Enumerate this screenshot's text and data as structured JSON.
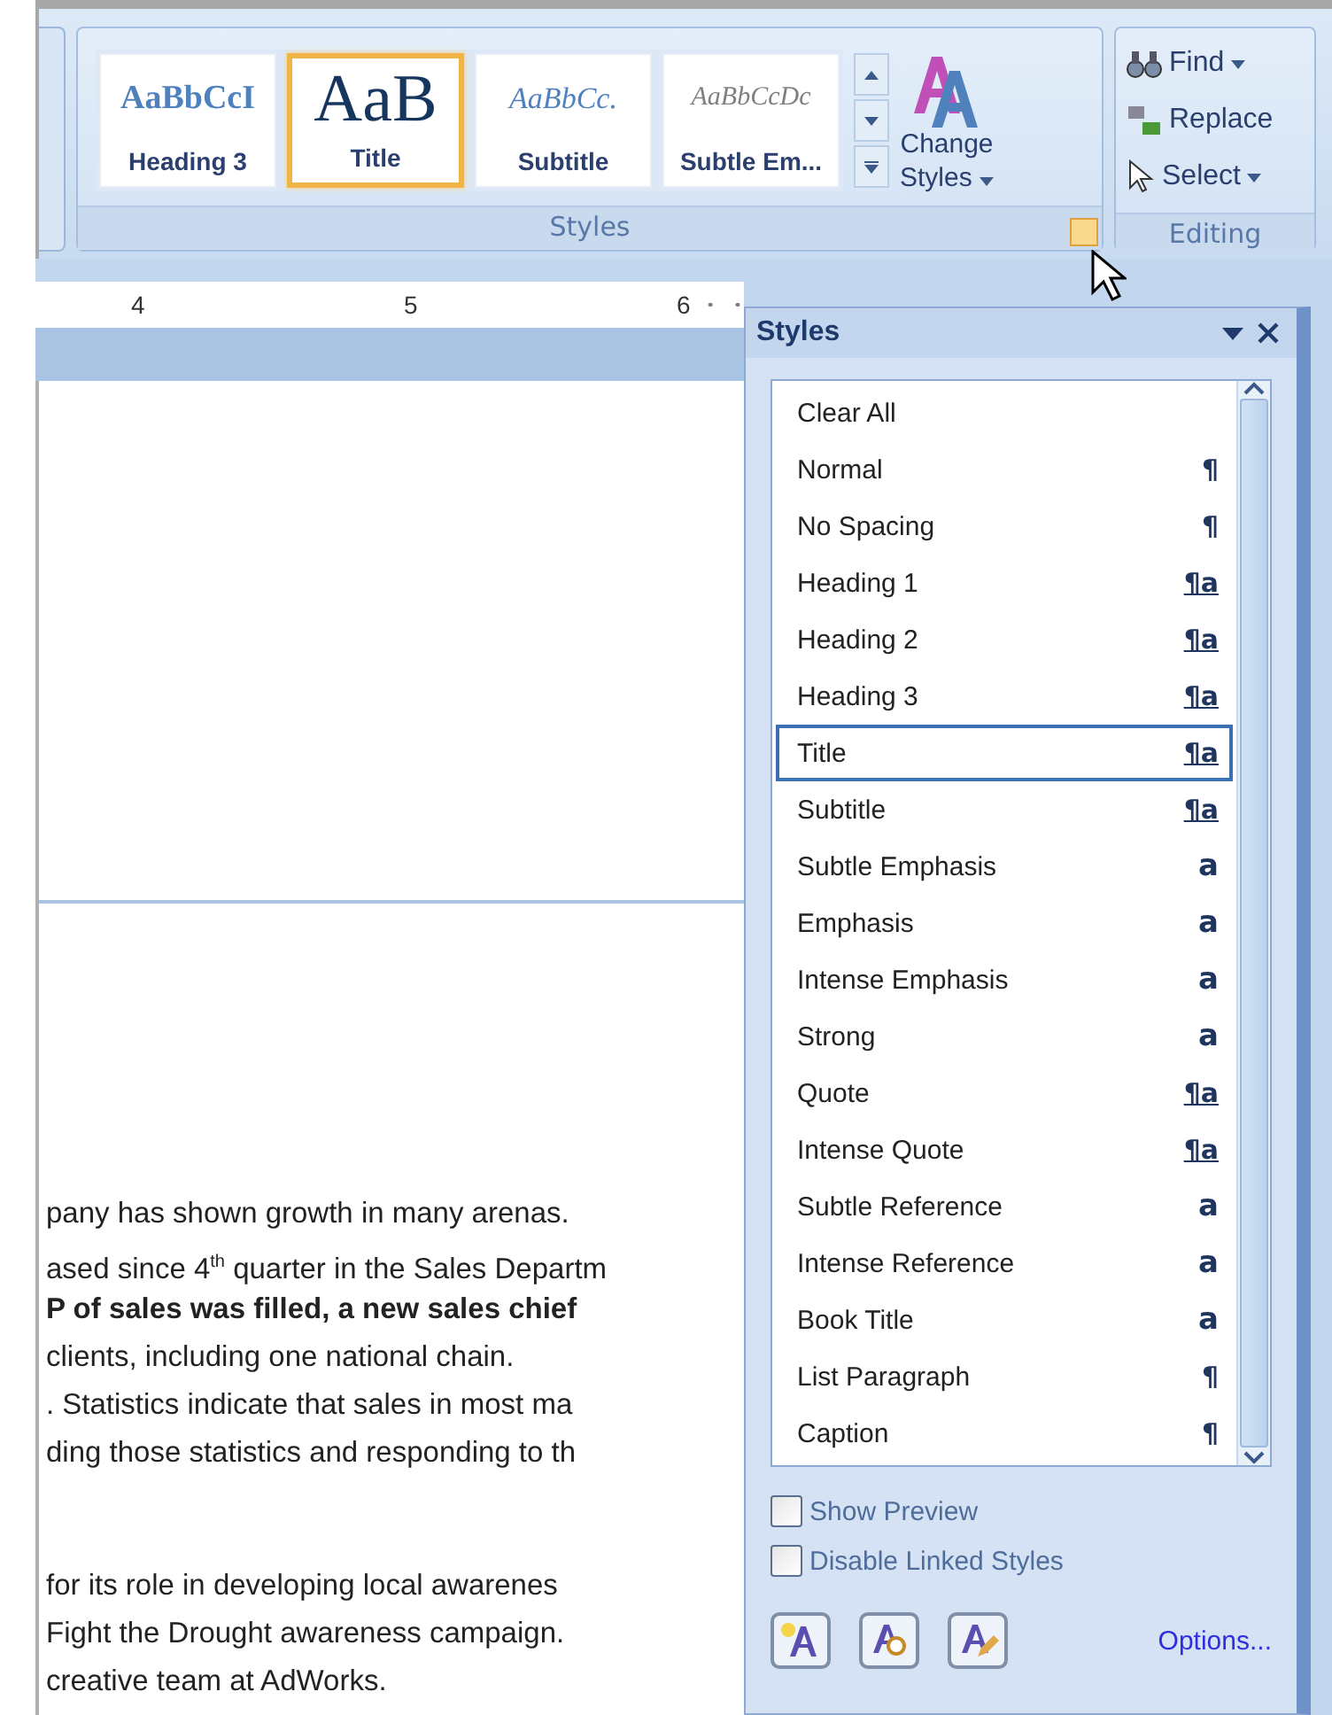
{
  "ribbon": {
    "gallery": [
      {
        "preview": "AaBbCcI",
        "label": "Heading 3",
        "kind": "heading",
        "selected": false
      },
      {
        "preview": "AaB",
        "label": "Title",
        "kind": "title",
        "selected": true
      },
      {
        "preview": "AaBbCc.",
        "label": "Subtitle",
        "kind": "subtitle",
        "selected": false
      },
      {
        "preview": "AaBbCcDc",
        "label": "Subtle Em...",
        "kind": "emphasis",
        "selected": false
      }
    ],
    "change_styles": [
      "Change",
      "Styles"
    ],
    "styles_label": "Styles",
    "editing": {
      "items": [
        {
          "label": "Find",
          "kind": "find",
          "dropdown": true
        },
        {
          "label": "Replace",
          "kind": "replace",
          "dropdown": false
        },
        {
          "label": "Select",
          "kind": "select",
          "dropdown": true
        }
      ],
      "label": "Editing"
    }
  },
  "ruler": [
    "4",
    "5",
    "6"
  ],
  "document": {
    "paragraphs": [
      [
        {
          "text": "pany has shown growth in many arenas.",
          "bold": false
        },
        {
          "text": "ased since 4$^{th}$ quarter in the Sales Departm",
          "bold": false
        },
        {
          "text": "P of sales was filled, a new sales chief",
          "bold": true
        },
        {
          "text": "clients, including one national chain.",
          "bold": false
        },
        {
          "text": ". Statistics indicate that sales in most ma",
          "bold": false
        },
        {
          "text": "ding those statistics and responding to th",
          "bold": false
        }
      ],
      [
        {
          "text": "for its role in developing local awarenes",
          "bold": false
        },
        {
          "text": "Fight the Drought awareness campaign.",
          "bold": false
        },
        {
          "text": "creative team at AdWorks.",
          "bold": false
        }
      ]
    ]
  },
  "styles_pane": {
    "title": "Styles",
    "items": [
      {
        "name": "Clear All",
        "kind": "none",
        "selected": false
      },
      {
        "name": "Normal",
        "kind": "paragraph",
        "mark": "¶",
        "selected": false
      },
      {
        "name": "No Spacing",
        "kind": "paragraph",
        "mark": "¶",
        "selected": false
      },
      {
        "name": "Heading 1",
        "kind": "linked",
        "mark": "¶a",
        "selected": false
      },
      {
        "name": "Heading 2",
        "kind": "linked",
        "mark": "¶a",
        "selected": false
      },
      {
        "name": "Heading 3",
        "kind": "linked",
        "mark": "¶a",
        "selected": false
      },
      {
        "name": "Title",
        "kind": "linked",
        "mark": "¶a",
        "selected": true
      },
      {
        "name": "Subtitle",
        "kind": "linked",
        "mark": "¶a",
        "selected": false
      },
      {
        "name": "Subtle Emphasis",
        "kind": "character",
        "mark": "a",
        "selected": false
      },
      {
        "name": "Emphasis",
        "kind": "character",
        "mark": "a",
        "selected": false
      },
      {
        "name": "Intense Emphasis",
        "kind": "character",
        "mark": "a",
        "selected": false
      },
      {
        "name": "Strong",
        "kind": "character",
        "mark": "a",
        "selected": false
      },
      {
        "name": "Quote",
        "kind": "linked",
        "mark": "¶a",
        "selected": false
      },
      {
        "name": "Intense Quote",
        "kind": "linked",
        "mark": "¶a",
        "selected": false
      },
      {
        "name": "Subtle Reference",
        "kind": "character",
        "mark": "a",
        "selected": false
      },
      {
        "name": "Intense Reference",
        "kind": "character",
        "mark": "a",
        "selected": false
      },
      {
        "name": "Book Title",
        "kind": "character",
        "mark": "a",
        "selected": false
      },
      {
        "name": "List Paragraph",
        "kind": "paragraph",
        "mark": "¶",
        "selected": false
      },
      {
        "name": "Caption",
        "kind": "paragraph",
        "mark": "¶",
        "selected": false
      }
    ],
    "options": [
      {
        "label": "Show Preview",
        "checked": false
      },
      {
        "label": "Disable Linked Styles",
        "checked": false
      }
    ],
    "options_link": "Options..."
  }
}
